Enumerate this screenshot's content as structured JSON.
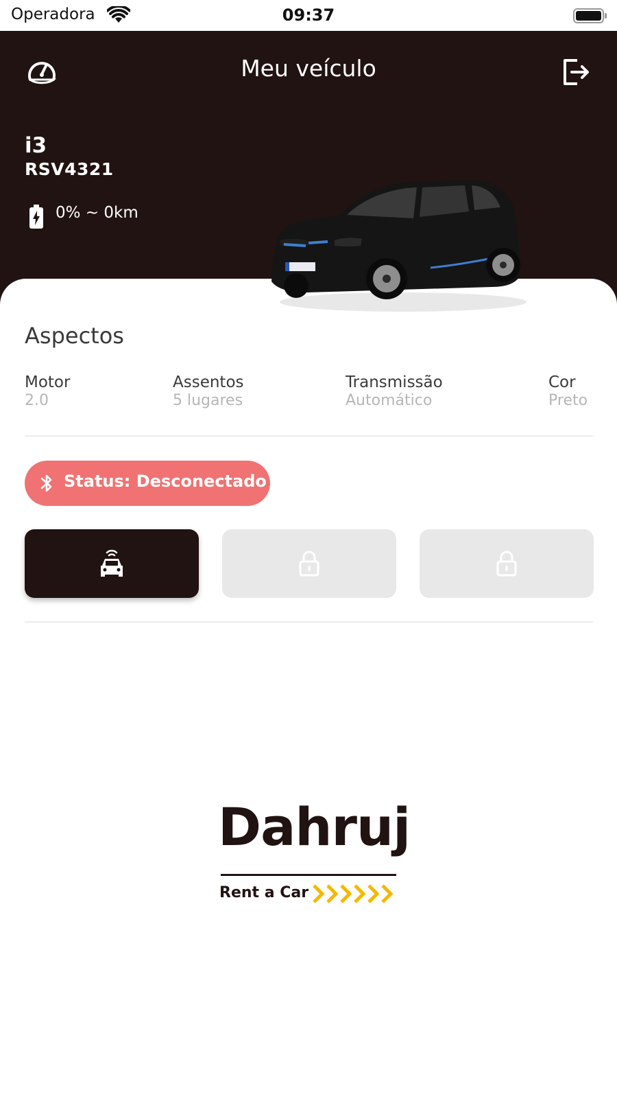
{
  "status_bar": {
    "carrier": "Operadora",
    "time": "09:37"
  },
  "header": {
    "title": "Meu veículo"
  },
  "vehicle": {
    "model": "i3",
    "plate": "RSV4321",
    "range": "0% ~ 0km"
  },
  "aspects": {
    "title": "Aspectos",
    "specs": [
      {
        "label": "Motor",
        "value": "2.0"
      },
      {
        "label": "Assentos",
        "value": "5 lugares"
      },
      {
        "label": "Transmissão",
        "value": "Automático"
      },
      {
        "label": "Cor",
        "value": "Preto"
      }
    ]
  },
  "connection": {
    "status_text": "Status: Desconectado"
  },
  "actions": [
    {
      "icon": "car-remote-icon",
      "state": "active"
    },
    {
      "icon": "lock-icon",
      "state": "disabled"
    },
    {
      "icon": "unlock-icon",
      "state": "disabled"
    }
  ],
  "brand": {
    "name": "Dahruj",
    "tagline": "Rent a Car"
  },
  "colors": {
    "header_bg": "#201311",
    "status_disconnected": "#f07272",
    "button_disabled": "#e8e8e8",
    "brand_accent": "#f5b800"
  }
}
